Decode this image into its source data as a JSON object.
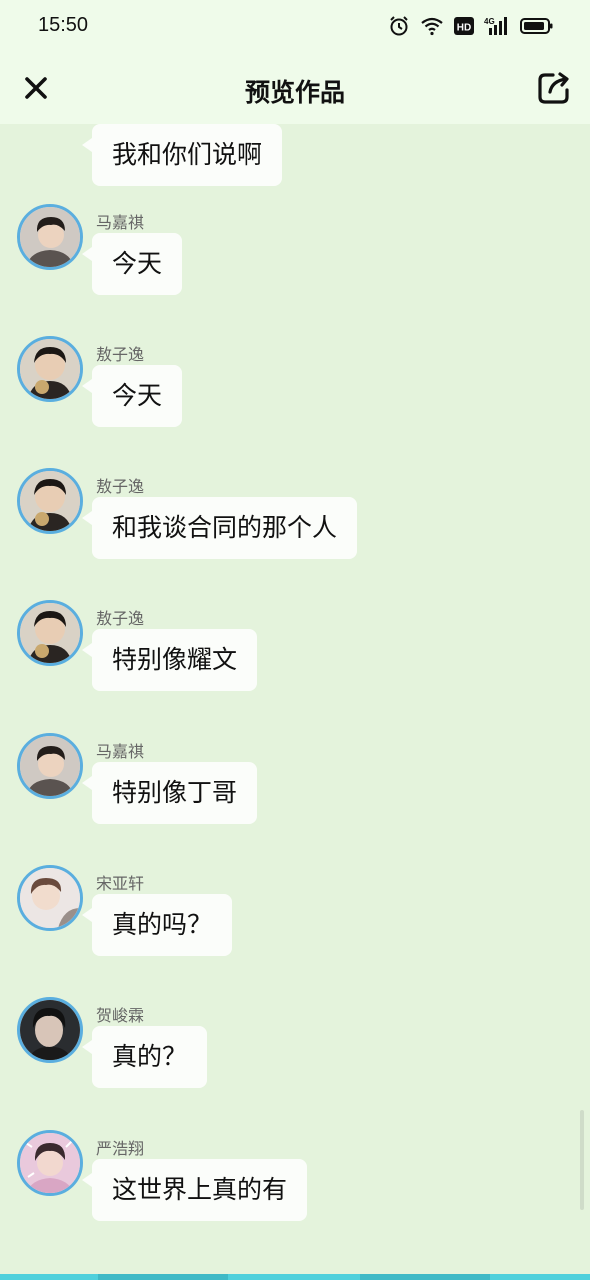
{
  "status_bar": {
    "time": "15:50",
    "icons": [
      "alarm-icon",
      "wifi-icon",
      "hd-icon",
      "4g-signal-icon",
      "battery-icon"
    ],
    "hd_label": "HD",
    "network_label": "4G"
  },
  "header": {
    "title": "预览作品",
    "close_icon": "close-icon",
    "share_icon": "share-icon"
  },
  "messages": [
    {
      "sender": "",
      "text": "我和你们说啊",
      "avatar": "avatar-ao"
    },
    {
      "sender": "马嘉祺",
      "text": "今天",
      "avatar": "avatar-ma"
    },
    {
      "sender": "敖子逸",
      "text": "今天",
      "avatar": "avatar-ao"
    },
    {
      "sender": "敖子逸",
      "text": "和我谈合同的那个人",
      "avatar": "avatar-ao"
    },
    {
      "sender": "敖子逸",
      "text": "特别像耀文",
      "avatar": "avatar-ao"
    },
    {
      "sender": "马嘉祺",
      "text": "特别像丁哥",
      "avatar": "avatar-ma"
    },
    {
      "sender": "宋亚轩",
      "text": "真的吗？",
      "avatar": "avatar-song"
    },
    {
      "sender": "贺峻霖",
      "text": "真的？",
      "avatar": "avatar-he"
    },
    {
      "sender": "严浩翔",
      "text": "这世界上真的有",
      "avatar": "avatar-yan"
    }
  ],
  "colors": {
    "background": "#e4f3dc",
    "header": "#effbea",
    "bubble": "#fbfdfa",
    "avatar_ring": "#5aaedf",
    "bottom_bar": "#4fd0dc"
  }
}
